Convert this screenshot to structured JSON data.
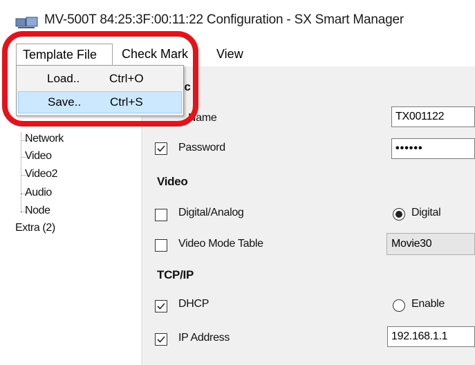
{
  "window": {
    "title": "MV-500T 84:25:3F:00:11:22  Configuration - SX Smart Manager",
    "icon": "monitor-app-icon"
  },
  "menubar": {
    "template_file": "Template File",
    "check_mark": "Check Mark",
    "view": "View"
  },
  "template_menu": {
    "items": [
      {
        "label": "Load..",
        "shortcut": "Ctrl+O"
      },
      {
        "label": "Save..",
        "shortcut": "Ctrl+S"
      }
    ]
  },
  "tree": {
    "items": [
      "Network",
      "Video",
      "Video2",
      "Audio",
      "Node"
    ],
    "extra": "Extra (2)"
  },
  "form": {
    "basic_header_fragment": "ic",
    "unit_name": {
      "label": "Name",
      "value": "TX001122"
    },
    "password": {
      "label": "Password",
      "value": "••••••",
      "checked": true
    },
    "video": {
      "header": "Video",
      "digital_analog": {
        "label": "Digital/Analog",
        "checked": false
      },
      "digital_radio": {
        "label": "Digital",
        "selected": true
      },
      "video_mode_table": {
        "label": "Video Mode Table",
        "checked": false
      },
      "video_mode_value": "Movie30"
    },
    "tcpip": {
      "header": "TCP/IP",
      "dhcp": {
        "label": "DHCP",
        "checked": true
      },
      "enable_radio": {
        "label": "Enable",
        "selected": false
      },
      "ip_address": {
        "label": "IP Address",
        "checked": true,
        "value": "192.168.1.1"
      }
    }
  },
  "colors": {
    "highlight_ring": "#e3131c",
    "menu_selection": "#cce8ff",
    "pane_background": "#f0f0f0"
  }
}
